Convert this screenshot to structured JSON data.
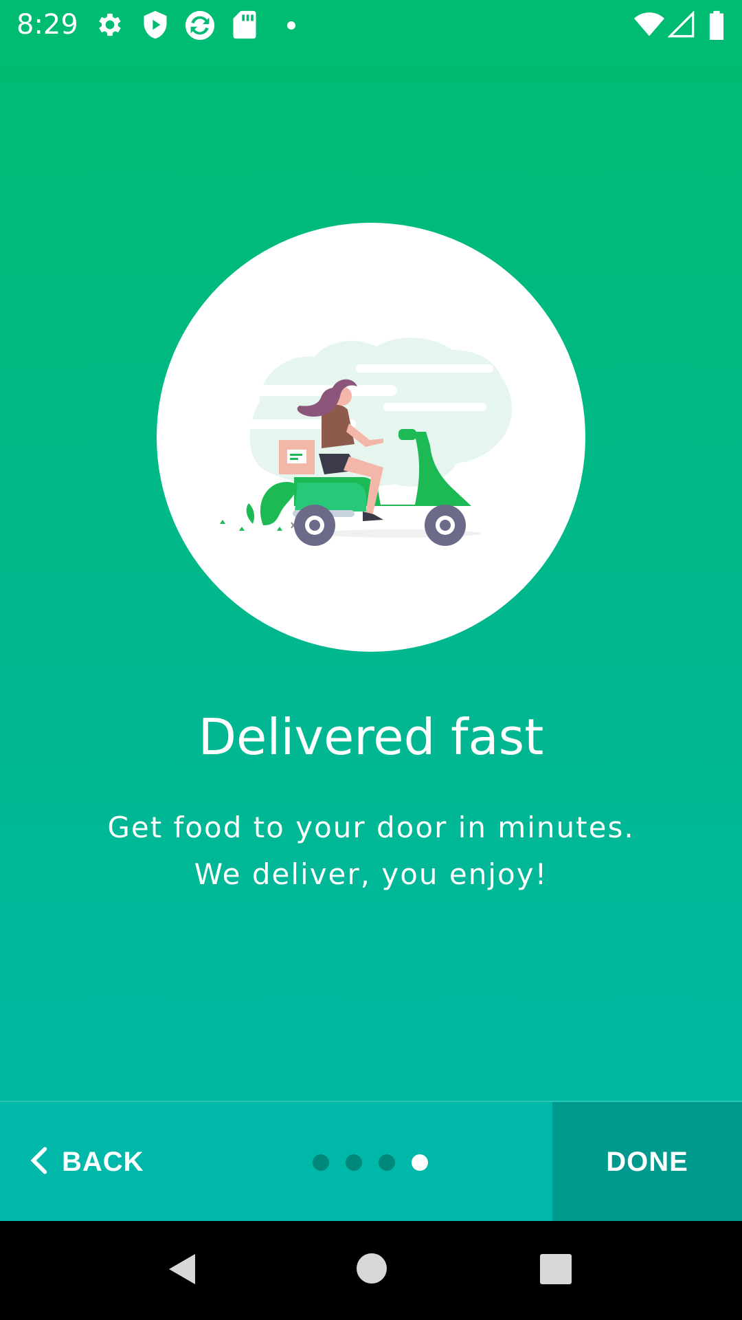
{
  "status_bar": {
    "time": "8:29",
    "icons": [
      "gear-icon",
      "shield-play-icon",
      "sync-app-icon",
      "sd-card-icon",
      "dot-icon",
      "wifi-icon",
      "cell-signal-icon",
      "battery-icon"
    ]
  },
  "slide": {
    "illustration": "delivery-scooter-illustration",
    "title": "Delivered fast",
    "description": "Get food to your door in minutes. We deliver, you enjoy!"
  },
  "controls": {
    "back_label": "BACK",
    "done_label": "DONE",
    "page_count": 4,
    "current_page": 4
  },
  "navigation_bar": {
    "buttons": [
      "back-triangle-icon",
      "home-circle-icon",
      "recents-square-icon"
    ]
  },
  "colors": {
    "gradient_top": "#00bb71",
    "gradient_bottom": "#00b8a6",
    "bottom_bar": "#00b8aa",
    "done_bg": "#009a8d",
    "dot_inactive": "#00897b",
    "scooter_green": "#1db954"
  }
}
